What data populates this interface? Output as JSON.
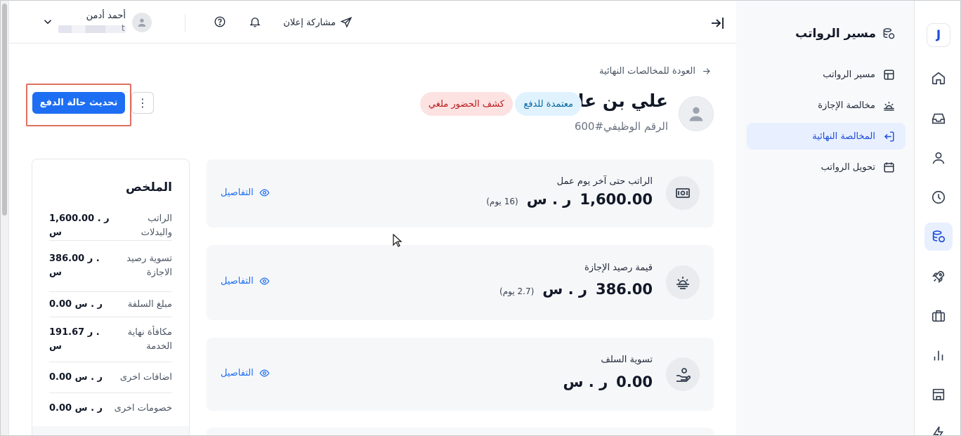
{
  "user": {
    "name": "أحمد أدمن",
    "email_tail": "t"
  },
  "topbar": {
    "share_label": "مشاركة إعلان"
  },
  "sidebar": {
    "title": "مسير الرواتب",
    "items": [
      {
        "label": "مسير الرواتب",
        "icon": "table-icon"
      },
      {
        "label": "مخالصة الإجازة",
        "icon": "sunrise-icon"
      },
      {
        "label": "المخالصة النهائية",
        "icon": "logout-icon"
      },
      {
        "label": "تحويل الرواتب",
        "icon": "calendar-icon"
      }
    ]
  },
  "page": {
    "back_label": "العودة للمخالصات النهائية",
    "employee_name": "علي بن علي",
    "employee_id": "الرقم الوظيفي#600",
    "status_badge": "معتمدة للدفع",
    "attendance_badge": "كشف الحضور ملغي",
    "update_button": "تحديث حالة الدفع",
    "kebab": "⋮"
  },
  "cards": [
    {
      "title": "الراتب حتى آخر يوم عمل",
      "amount": "1,600.00",
      "currency": "ر . س",
      "days": "(16 يوم)",
      "details": "التفاصيل"
    },
    {
      "title": "قيمة رصيد الإجازة",
      "amount": "386.00",
      "currency": "ر . س",
      "days": "(2.7 يوم)",
      "details": "التفاصيل"
    },
    {
      "title": "تسوية السلف",
      "amount": "0.00",
      "currency": "ر . س",
      "days": "",
      "details": "التفاصيل"
    }
  ],
  "summary": {
    "title": "الملخص",
    "rows": [
      {
        "label": "الراتب والبدلات",
        "value": "1,600.00 ر . س"
      },
      {
        "label": "تسوية رصيد الاجازة",
        "value": "386.00 ر .\nس"
      },
      {
        "label": "مبلغ السلفة",
        "value": "0.00 ر . س"
      },
      {
        "label": "مكافأة نهاية الخدمة",
        "value": "191.67 ر .\nس"
      },
      {
        "label": "اضافات اخرى",
        "value": "0.00 ر . س"
      },
      {
        "label": "خصومات اخرى",
        "value": "0.00 ر . س"
      }
    ]
  },
  "colors": {
    "primary": "#1d6ef2",
    "active_bg": "#e8efff",
    "badge_blue_bg": "#e0f2fe",
    "badge_red_bg": "#fde2e2"
  }
}
